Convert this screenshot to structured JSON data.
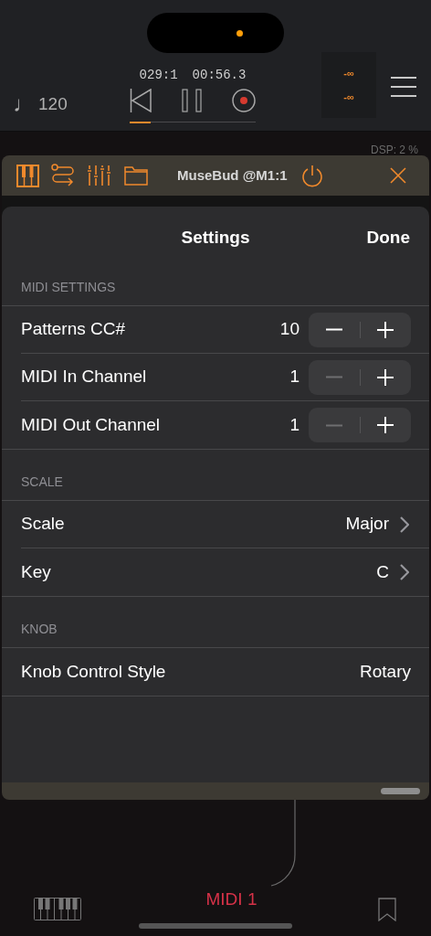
{
  "transport": {
    "tempo_icon": "♩",
    "tempo": "120",
    "position": "029:1",
    "time": "00:56.3",
    "progress": {
      "level": 0.17
    },
    "recording": true,
    "meter": [
      "-∞",
      "-∞"
    ]
  },
  "dsp": "DSP: 2 %",
  "plugin": {
    "title": "MuseBud @M1:1"
  },
  "sheet": {
    "title": "Settings",
    "done": "Done",
    "sections": [
      {
        "header": "MIDI SETTINGS",
        "rows": [
          {
            "kind": "stepper",
            "label": "Patterns CC#",
            "value": "10",
            "decrement_disabled": false
          },
          {
            "kind": "stepper",
            "label": "MIDI In Channel",
            "value": "1",
            "decrement_disabled": true
          },
          {
            "kind": "stepper",
            "label": "MIDI Out Channel",
            "value": "1",
            "decrement_disabled": true
          }
        ]
      },
      {
        "header": "SCALE",
        "rows": [
          {
            "kind": "link",
            "label": "Scale",
            "value": "Major"
          },
          {
            "kind": "link",
            "label": "Key",
            "value": "C"
          }
        ]
      },
      {
        "header": "KNOB",
        "rows": [
          {
            "kind": "value",
            "label": "Knob Control Style",
            "value": "Rotary"
          }
        ]
      }
    ]
  },
  "bottom": {
    "track": "MIDI 1"
  }
}
